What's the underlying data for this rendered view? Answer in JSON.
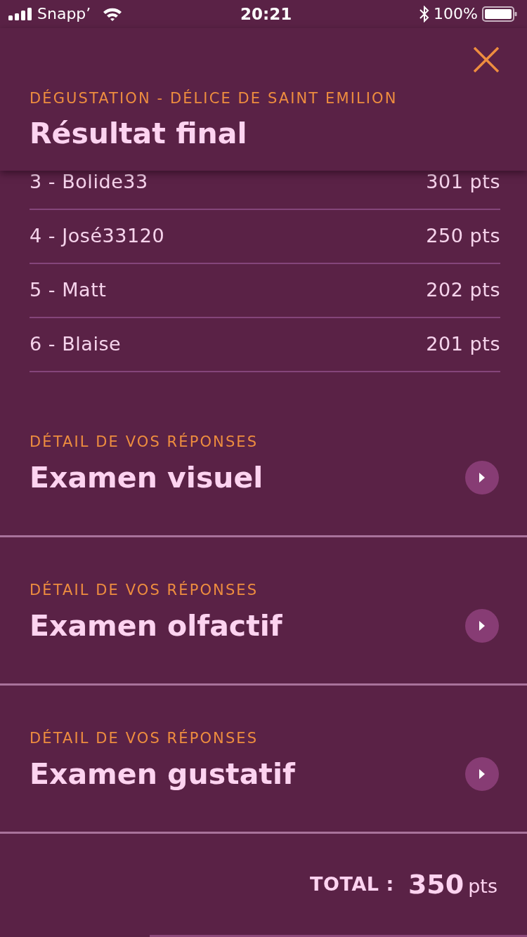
{
  "status_bar": {
    "carrier": "Snapp’",
    "time": "20:21",
    "battery": "100%"
  },
  "header": {
    "subtitle": "DÉGUSTATION - DÉLICE DE SAINT EMILION",
    "title": "Résultat final"
  },
  "ranking": [
    {
      "name": "3 - Bolide33",
      "score": "301 pts"
    },
    {
      "name": "4 - José33120",
      "score": "250 pts"
    },
    {
      "name": "5 - Matt",
      "score": "202 pts"
    },
    {
      "name": "6 - Blaise",
      "score": "201 pts"
    }
  ],
  "sections": [
    {
      "label": "DÉTAIL DE VOS RÉPONSES",
      "title": "Examen visuel"
    },
    {
      "label": "DÉTAIL DE VOS RÉPONSES",
      "title": "Examen olfactif"
    },
    {
      "label": "DÉTAIL DE VOS RÉPONSES",
      "title": "Examen gustatif"
    }
  ],
  "total": {
    "label": "TOTAL :",
    "value": "350",
    "unit": "pts"
  }
}
